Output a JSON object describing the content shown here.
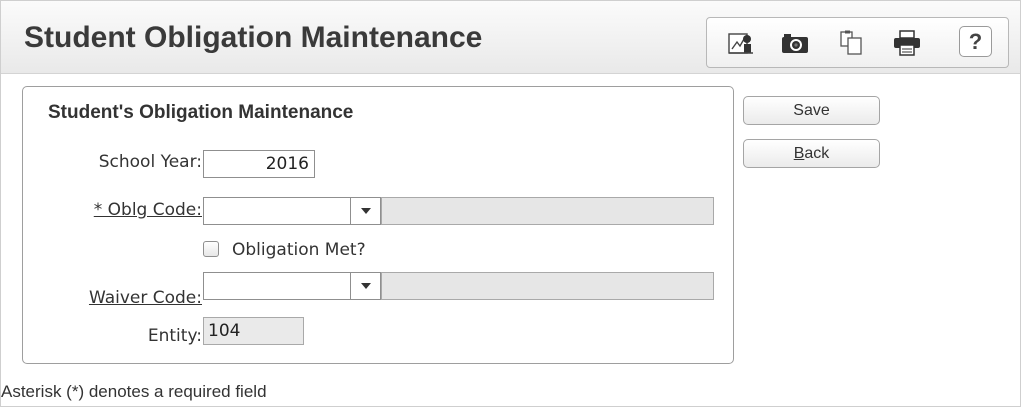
{
  "header": {
    "title": "Student Obligation Maintenance",
    "toolbar": {
      "icons": [
        "report-icon",
        "camera-icon",
        "copy-icon",
        "print-icon",
        "help-icon"
      ],
      "help_label": "?"
    }
  },
  "form": {
    "title": "Student's Obligation Maintenance",
    "school_year": {
      "label": "School Year:",
      "value": "2016"
    },
    "oblg_code": {
      "label": "* Oblg Code:",
      "value": "",
      "description": ""
    },
    "obligation_met": {
      "label": "Obligation Met?",
      "checked": false
    },
    "waiver_code": {
      "label": "Waiver Code:",
      "value": "",
      "description": ""
    },
    "entity": {
      "label": "Entity:",
      "value": "104"
    }
  },
  "actions": {
    "save": {
      "label": "Save"
    },
    "back": {
      "label_mnemonic": "B",
      "label_rest": "ack"
    }
  },
  "footnote": "Asterisk (*) denotes a required field"
}
